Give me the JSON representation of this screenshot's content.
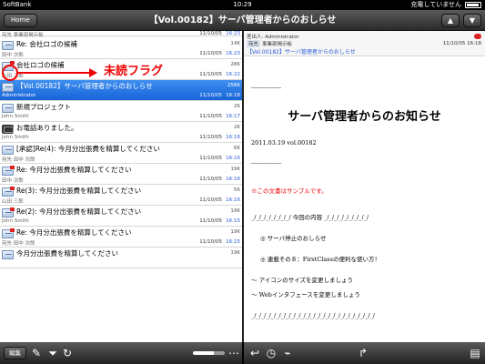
{
  "status": {
    "carrier": "SoftBank",
    "time": "10:29",
    "charging": "充電していません"
  },
  "nav": {
    "home_label": "Home",
    "title": "【Vol.00182】サーバ管理者からのおしらせ",
    "up": "▲",
    "down": "▼"
  },
  "list": {
    "rows": [
      {
        "sender": "宛先 事業部掲示板",
        "date": "11/10/05",
        "time": "16:23"
      },
      {
        "subject": "Re: 会社ロゴの候補",
        "size": "14K",
        "sender": "田中 次郎",
        "date": "11/10/05",
        "time": "16:23"
      },
      {
        "subject": "会社ロゴの候補",
        "size": "28K",
        "sender": "山田 三郎",
        "date": "11/10/05",
        "time": "16:22"
      },
      {
        "subject": "【Vol.00182】サーバ管理者からのおしらせ",
        "size": "256K",
        "sender": "Administrator",
        "date": "11/10/05",
        "time": "16:18"
      },
      {
        "subject": "新規プロジェクト",
        "size": "2K",
        "sender": "John Smith",
        "date": "11/10/05",
        "time": "16:17"
      },
      {
        "subject": "お電話ありました。",
        "size": "2K",
        "sender": "John Smith",
        "date": "11/10/05",
        "time": "16:16"
      },
      {
        "subject": "[承認]Re(4): 今月分出張費を精算してください",
        "size": "6K",
        "sender": "宛先 田中 次郎",
        "date": "11/10/05",
        "time": "16:16"
      },
      {
        "subject": "Re: 今月分出張費を精算してください",
        "size": "19K",
        "sender": "田中 次郎",
        "date": "11/10/05",
        "time": "16:16"
      },
      {
        "subject": "Re(3): 今月分出張費を精算してください",
        "size": "5K",
        "sender": "山田 三郎",
        "date": "11/10/05",
        "time": "16:16"
      },
      {
        "subject": "Re(2): 今月分出張費を精算してください",
        "size": "19K",
        "sender": "John Smith",
        "date": "11/10/05",
        "time": "16:15"
      },
      {
        "subject": "Re: 今月分出張費を精算してください",
        "size": "19K",
        "sender": "宛先 田中 次郎",
        "date": "11/10/05",
        "time": "16:15"
      },
      {
        "subject": "今月分出張費を精算してください",
        "size": "19K",
        "sender": "",
        "date": "",
        "time": ""
      }
    ]
  },
  "annotation": {
    "label": "未読フラグ"
  },
  "detail": {
    "from_label": "差出人: Administrator",
    "to_tag": "宛先",
    "to_value": "事業部掲示板",
    "date": "11/10/05 16:18",
    "subject": "【Vol.00182】サーバ管理者からのおしらせ",
    "body": {
      "rule_1": "---------------",
      "title": "サーバ管理者からのお知らせ",
      "issue": "2011.03.19 vol.00182",
      "rule_2": "---------------",
      "note": "※この文書はサンプルです。",
      "contents": "_/_/_/_/_/_/_/_/   今回の内容   _/_/_/_/_/_/_/_/_/",
      "item_1": "◎   サーバ停止のおしらせ",
      "item_2": "◎   連載その８：FirstClassの便利な使い方！",
      "item_3": "～   アイコンのサイズを変更しましょう",
      "item_4": "～   Webインタフェースを変更しましょう",
      "rule_3": "_/_/_/_/_/_/_/_/_/_/_/_/_/_/_/_/_/_/_/_/_/_/_/_/_/"
    }
  },
  "toolbar": {
    "edit_label": "編集",
    "progress": 0.65
  }
}
